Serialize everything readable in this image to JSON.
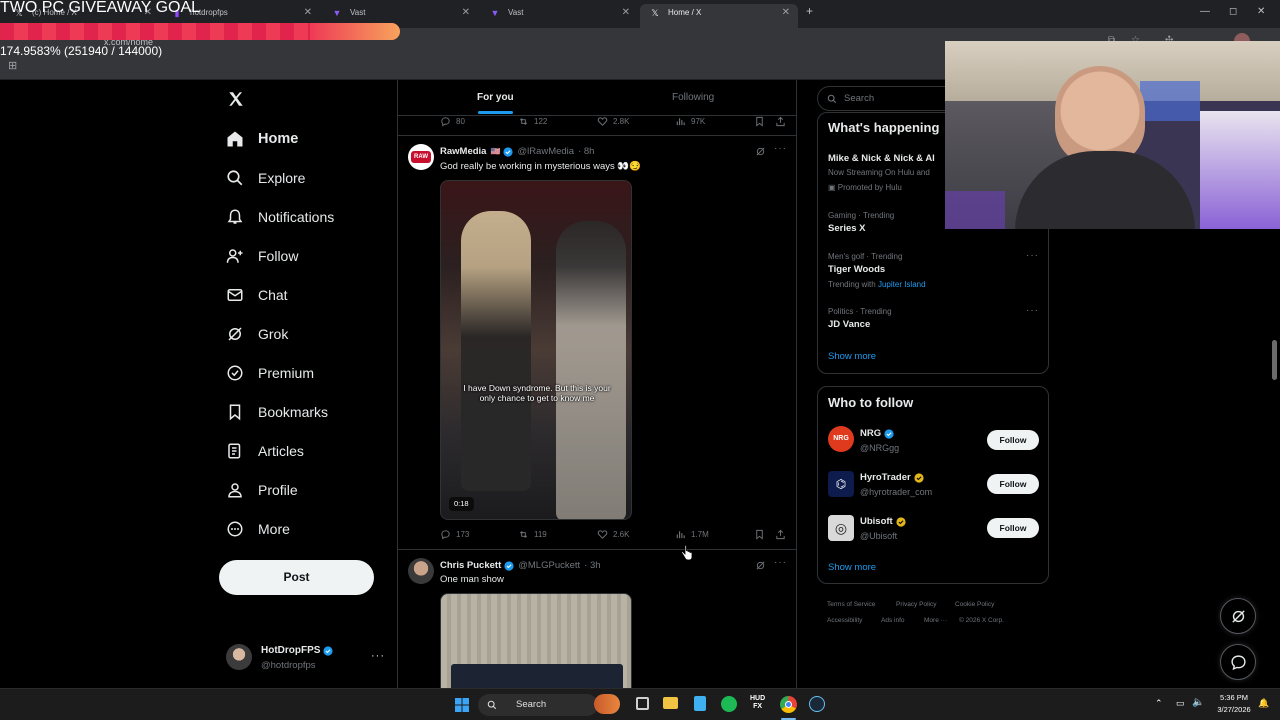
{
  "overlay": {
    "giveaway_title": "TWO PC GIVEAWAY GOAL",
    "progress_text": "174.9583% (251940 / 144000)",
    "progress_fraction": 1.7496
  },
  "browser": {
    "tabs": [
      {
        "label": "(c) Home / X",
        "icon": "x-icon",
        "active": false
      },
      {
        "label": "hotdropfps",
        "icon": "twitch-icon",
        "active": false
      },
      {
        "label": "Vast",
        "icon": "vast-icon",
        "active": false
      },
      {
        "label": "Vast",
        "icon": "vast-icon",
        "active": false
      },
      {
        "label": "Home / X",
        "icon": "x-icon",
        "active": true
      }
    ],
    "new_tab": "+",
    "url": "x.com/home"
  },
  "nav": {
    "items": [
      {
        "label": "Home",
        "icon": "home-icon"
      },
      {
        "label": "Explore",
        "icon": "search-icon"
      },
      {
        "label": "Notifications",
        "icon": "bell-icon"
      },
      {
        "label": "Follow",
        "icon": "person-add-icon"
      },
      {
        "label": "Chat",
        "icon": "mail-icon"
      },
      {
        "label": "Grok",
        "icon": "grok-icon"
      },
      {
        "label": "Premium",
        "icon": "premium-icon"
      },
      {
        "label": "Bookmarks",
        "icon": "bookmark-icon"
      },
      {
        "label": "Articles",
        "icon": "article-icon"
      },
      {
        "label": "Profile",
        "icon": "person-icon"
      },
      {
        "label": "More",
        "icon": "more-circle-icon"
      }
    ],
    "post_label": "Post",
    "account": {
      "name": "HotDropFPS",
      "handle": "@hotdropfps"
    }
  },
  "feed": {
    "tabs": [
      "For you",
      "Following"
    ],
    "prev_actions": {
      "replies": "80",
      "reposts": "122",
      "likes": "2.8K",
      "views": "97K"
    },
    "tweets": [
      {
        "name": "RawMedia",
        "handle": "@lRawMedia",
        "time": "· 8h",
        "text": "God really be working in mysterious ways 👀😏",
        "caption_line1": "I have Down syndrome. But this is your",
        "caption_line2": "only chance to get to know me",
        "duration": "0:18",
        "replies": "173",
        "reposts": "119",
        "likes": "2.6K",
        "views": "1.7M"
      },
      {
        "name": "Chris Puckett",
        "handle": "@MLGPuckett",
        "time": "· 3h",
        "text": "One man show"
      }
    ]
  },
  "sidebar": {
    "search_placeholder": "Search",
    "happening_title": "What's happening",
    "trends": [
      {
        "title": "Mike & Nick & Nick & Al",
        "sub": "Now Streaming On Hulu and",
        "promo": "Promoted by Hulu"
      },
      {
        "meta": "Gaming · Trending",
        "title": "Series X"
      },
      {
        "meta": "Men's golf · Trending",
        "title": "Tiger Woods",
        "sub_prefix": "Trending with",
        "sub_link": "Jupiter Island"
      },
      {
        "meta": "Politics · Trending",
        "title": "JD Vance"
      }
    ],
    "show_more": "Show more",
    "who_to_follow_title": "Who to follow",
    "who_to_follow": [
      {
        "name": "NRG",
        "handle": "@NRGgg",
        "badge": "blue",
        "button": "Follow"
      },
      {
        "name": "HyroTrader",
        "handle": "@hyrotrader_com",
        "badge": "gold",
        "button": "Follow"
      },
      {
        "name": "Ubisoft",
        "handle": "@Ubisoft",
        "badge": "gold",
        "button": "Follow"
      }
    ],
    "footer": [
      "Terms of Service",
      "Privacy Policy",
      "Cookie Policy",
      "Accessibility",
      "Ads info",
      "More ···",
      "© 2026 X Corp."
    ]
  },
  "taskbar": {
    "search_label": "Search",
    "time": "5:36 PM",
    "date": "3/27/2026"
  },
  "colors": {
    "accent": "#1d9bf0",
    "background": "#000000",
    "border": "#2f3336",
    "muted": "#71767b",
    "gold_badge": "#e2b719",
    "goal_bar": "#e0244b"
  }
}
